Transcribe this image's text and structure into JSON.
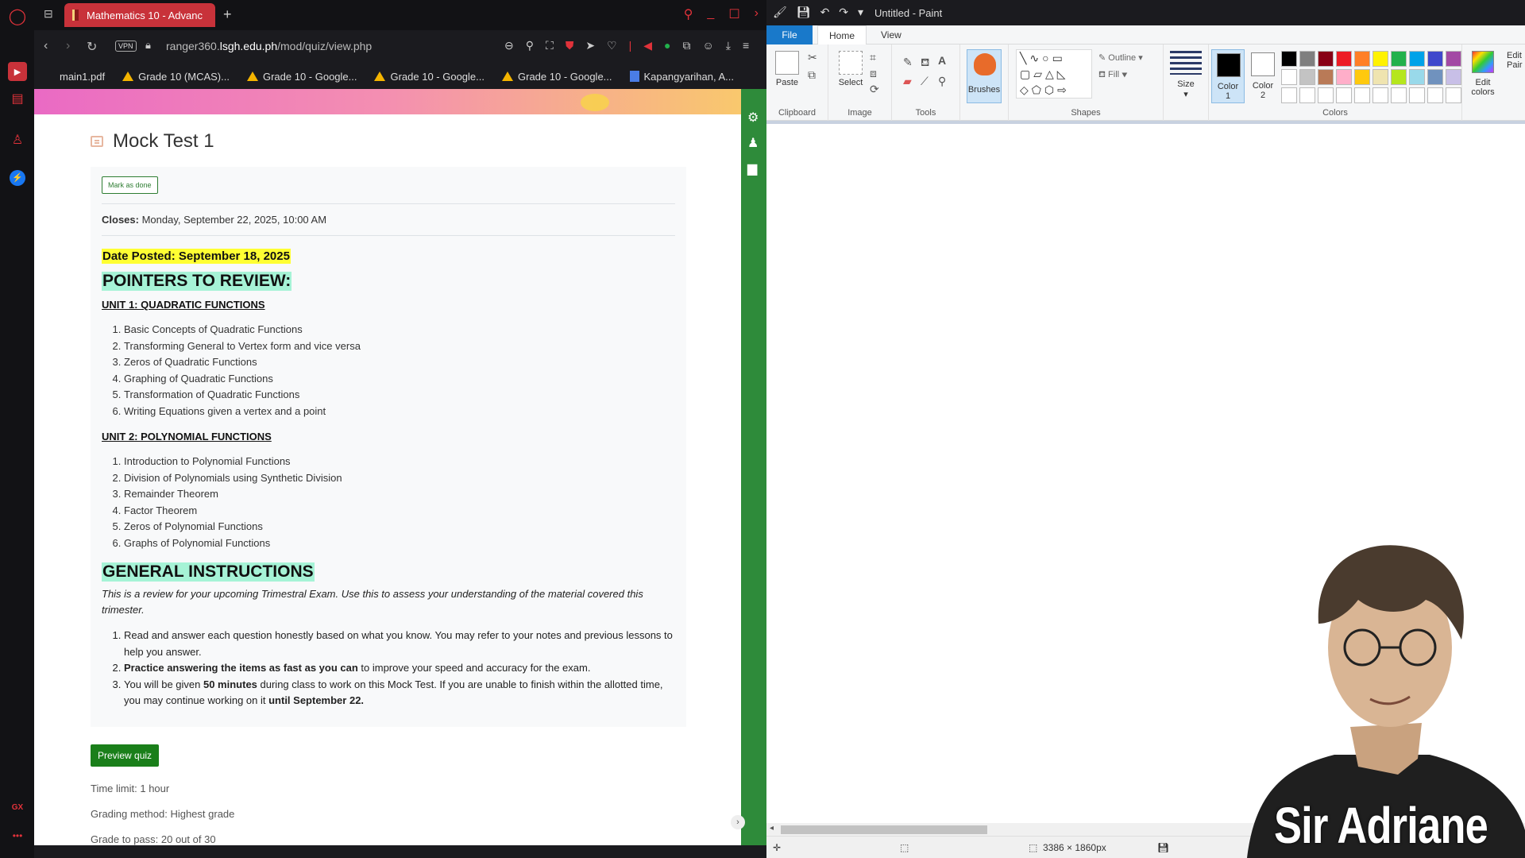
{
  "browser": {
    "tab_title": "Mathematics 10 - Advanc",
    "url_host": "ranger360.",
    "url_domain": "lsgh.edu.ph",
    "url_path": "/mod/quiz/view.php",
    "vpn_label": "VPN",
    "bookmarks": [
      {
        "label": "main1.pdf",
        "icon": "none"
      },
      {
        "label": "Grade 10 (MCAS)...",
        "icon": "drive"
      },
      {
        "label": "Grade 10 - Google...",
        "icon": "drive"
      },
      {
        "label": "Grade 10 - Google...",
        "icon": "drive"
      },
      {
        "label": "Grade 10 - Google...",
        "icon": "drive"
      },
      {
        "label": "Kapangyarihan, A...",
        "icon": "doc"
      }
    ]
  },
  "quiz": {
    "title": "Mock Test 1",
    "mark_done": "Mark as done",
    "closes_label": "Closes:",
    "closes_value": " Monday, September 22, 2025, 10:00 AM",
    "date_posted": "Date Posted: September 18, 2025",
    "pointers_heading": "POINTERS TO REVIEW:",
    "unit1": {
      "title": "UNIT 1: QUADRATIC FUNCTIONS",
      "items": [
        "Basic Concepts of Quadratic Functions",
        "Transforming General to Vertex form and vice versa",
        "Zeros of Quadratic Functions",
        "Graphing of Quadratic Functions",
        "Transformation of Quadratic Functions",
        "Writing Equations given a vertex and a point"
      ]
    },
    "unit2": {
      "title": "UNIT 2: POLYNOMIAL FUNCTIONS",
      "items": [
        "Introduction to Polynomial Functions",
        "Division of Polynomials using Synthetic Division",
        "Remainder Theorem",
        "Factor Theorem",
        "Zeros of Polynomial Functions",
        "Graphs of Polynomial Functions"
      ]
    },
    "instructions_heading": "GENERAL INSTRUCTIONS",
    "intro": "This is a review for your upcoming Trimestral Exam. Use this to assess your understanding of the material covered this trimester.",
    "instructions": {
      "i1": "Read and answer each question honestly based on what you know. You may refer to your notes and previous lessons to help you answer.",
      "i2_bold": "Practice answering the items as fast as you can",
      "i2_rest": " to improve your speed and accuracy for the exam.",
      "i3_a": "You will be given ",
      "i3_bold1": "50 minutes",
      "i3_b": " during class to work on this Mock Test. If you are unable to finish within the allotted time, you may continue working on it ",
      "i3_bold2": "until September 22."
    },
    "preview_button": "Preview quiz",
    "time_limit": "Time limit: 1 hour",
    "grading_method": "Grading method: Highest grade",
    "grade_to_pass": "Grade to pass: 20 out of 30"
  },
  "paint": {
    "title": "Untitled - Paint",
    "tabs": {
      "file": "File",
      "home": "Home",
      "view": "View"
    },
    "groups": {
      "clipboard": "Clipboard",
      "image": "Image",
      "tools": "Tools",
      "shapes": "Shapes",
      "colors": "Colors"
    },
    "buttons": {
      "paste": "Paste",
      "select": "Select",
      "brushes": "Brushes",
      "outline": "Outline",
      "fill": "Fill",
      "size": "Size",
      "color1_line1": "Color",
      "color1_line2": "1",
      "color2_line1": "Color",
      "color2_line2": "2",
      "edit_colors_line1": "Edit",
      "edit_colors_line2": "colors",
      "edit_paint_line1": "Edit",
      "edit_paint_line2": "Pair"
    },
    "color1": "#000000",
    "color2": "#ffffff",
    "palette": [
      "#000000",
      "#7f7f7f",
      "#880015",
      "#ed1c24",
      "#ff7f27",
      "#fff200",
      "#22b14c",
      "#00a2e8",
      "#3f48cc",
      "#a349a4",
      "#ffffff",
      "#c3c3c3",
      "#b97a57",
      "#ffaec9",
      "#ffc90e",
      "#efe4b0",
      "#b5e61d",
      "#99d9ea",
      "#7092be",
      "#c8bfe7",
      "#ffffff",
      "#ffffff",
      "#ffffff",
      "#ffffff",
      "#ffffff",
      "#ffffff",
      "#ffffff",
      "#ffffff",
      "#ffffff",
      "#ffffff"
    ],
    "dimensions": "3386 × 1860px"
  },
  "overlay": {
    "presenter_name": "Sir Adriane"
  }
}
